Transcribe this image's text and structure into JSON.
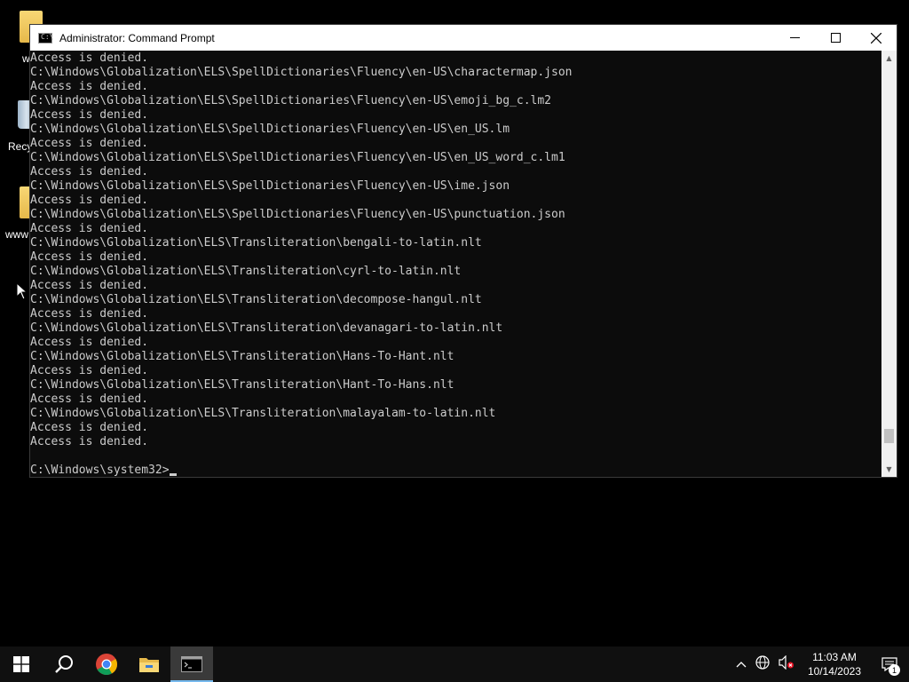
{
  "desktop": {
    "icons": [
      {
        "label": "w"
      },
      {
        "label": "Recy"
      },
      {
        "label": "www"
      }
    ]
  },
  "window": {
    "title": "Administrator: Command Prompt",
    "controls": {
      "minimize": "—",
      "maximize": "☐",
      "close": "✕"
    },
    "console_lines": [
      "Access is denied.",
      "C:\\Windows\\Globalization\\ELS\\SpellDictionaries\\Fluency\\en-US\\charactermap.json",
      "Access is denied.",
      "C:\\Windows\\Globalization\\ELS\\SpellDictionaries\\Fluency\\en-US\\emoji_bg_c.lm2",
      "Access is denied.",
      "C:\\Windows\\Globalization\\ELS\\SpellDictionaries\\Fluency\\en-US\\en_US.lm",
      "Access is denied.",
      "C:\\Windows\\Globalization\\ELS\\SpellDictionaries\\Fluency\\en-US\\en_US_word_c.lm1",
      "Access is denied.",
      "C:\\Windows\\Globalization\\ELS\\SpellDictionaries\\Fluency\\en-US\\ime.json",
      "Access is denied.",
      "C:\\Windows\\Globalization\\ELS\\SpellDictionaries\\Fluency\\en-US\\punctuation.json",
      "Access is denied.",
      "C:\\Windows\\Globalization\\ELS\\Transliteration\\bengali-to-latin.nlt",
      "Access is denied.",
      "C:\\Windows\\Globalization\\ELS\\Transliteration\\cyrl-to-latin.nlt",
      "Access is denied.",
      "C:\\Windows\\Globalization\\ELS\\Transliteration\\decompose-hangul.nlt",
      "Access is denied.",
      "C:\\Windows\\Globalization\\ELS\\Transliteration\\devanagari-to-latin.nlt",
      "Access is denied.",
      "C:\\Windows\\Globalization\\ELS\\Transliteration\\Hans-To-Hant.nlt",
      "Access is denied.",
      "C:\\Windows\\Globalization\\ELS\\Transliteration\\Hant-To-Hans.nlt",
      "Access is denied.",
      "C:\\Windows\\Globalization\\ELS\\Transliteration\\malayalam-to-latin.nlt",
      "Access is denied.",
      "Access is denied.",
      ""
    ],
    "prompt": "C:\\Windows\\system32>",
    "scroll": {
      "up": "▲",
      "down": "▼",
      "position_fraction": 0.95
    }
  },
  "taskbar": {
    "icons": [
      "windows-start-icon",
      "search-icon",
      "chrome-icon",
      "file-explorer-icon",
      "command-prompt-icon"
    ],
    "tray": {
      "chevron": "^",
      "time": "11:03 AM",
      "date": "10/14/2023",
      "notifications_count": "1"
    }
  },
  "colors": {
    "console_bg": "#0c0c0c",
    "console_text": "#cccccc",
    "taskbar_bg": "#101010",
    "accent": "#76b9ed"
  }
}
